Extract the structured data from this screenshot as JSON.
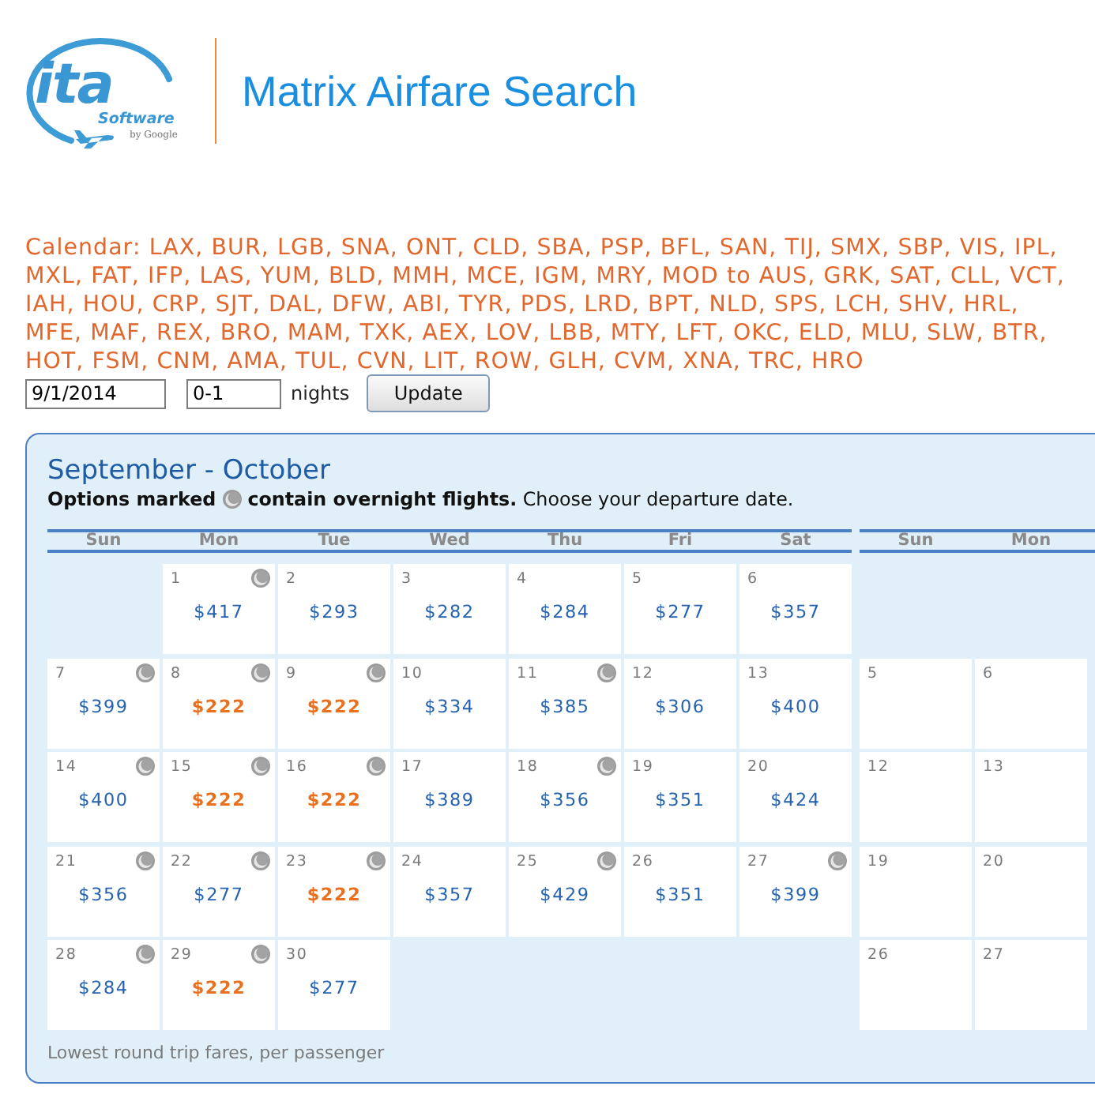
{
  "header": {
    "logo": {
      "wordmark": "ita",
      "product": "Software",
      "byline": "by Google"
    },
    "title": "Matrix Airfare Search"
  },
  "route": "Calendar: LAX, BUR, LGB, SNA, ONT, CLD, SBA, PSP, BFL, SAN, TIJ, SMX, SBP, VIS, IPL, MXL, FAT, IFP, LAS, YUM, BLD, MMH, MCE, IGM, MRY, MOD to AUS, GRK, SAT, CLL, VCT, IAH, HOU, CRP, SJT, DAL, DFW, ABI, TYR, PDS, LRD, BPT, NLD, SPS, LCH, SHV, HRL, MFE, MAF, REX, BRO, MAM, TXK, AEX, LOV, LBB, MTY, LFT, OKC, ELD, MLU, SLW, BTR, HOT, FSM, CNM, AMA, TUL, CVN, LIT, ROW, GLH, CVM, XNA, TRC, HRO",
  "form": {
    "date": "9/1/2014",
    "nights": "0-1",
    "nights_label": "nights",
    "button": "Update"
  },
  "calendar": {
    "title": "September - October",
    "legend": {
      "lead": "Options marked",
      "rest": "**contain overnight flights.** Choose your departure date."
    },
    "months": [
      {
        "weekdays": [
          "Sun",
          "Mon",
          "Tue",
          "Wed",
          "Thu",
          "Fri",
          "Sat"
        ],
        "weeks": [
          [
            {
              "kind": "empty"
            },
            {
              "kind": "day",
              "day": "1",
              "price": "$417",
              "overnight": true,
              "lowest": false
            },
            {
              "kind": "day",
              "day": "2",
              "price": "$293",
              "overnight": false,
              "lowest": false
            },
            {
              "kind": "day",
              "day": "3",
              "price": "$282",
              "overnight": false,
              "lowest": false
            },
            {
              "kind": "day",
              "day": "4",
              "price": "$284",
              "overnight": false,
              "lowest": false
            },
            {
              "kind": "day",
              "day": "5",
              "price": "$277",
              "overnight": false,
              "lowest": false
            },
            {
              "kind": "day",
              "day": "6",
              "price": "$357",
              "overnight": false,
              "lowest": false
            }
          ],
          [
            {
              "kind": "day",
              "day": "7",
              "price": "$399",
              "overnight": true,
              "lowest": false
            },
            {
              "kind": "day",
              "day": "8",
              "price": "$222",
              "overnight": true,
              "lowest": true
            },
            {
              "kind": "day",
              "day": "9",
              "price": "$222",
              "overnight": true,
              "lowest": true
            },
            {
              "kind": "day",
              "day": "10",
              "price": "$334",
              "overnight": false,
              "lowest": false
            },
            {
              "kind": "day",
              "day": "11",
              "price": "$385",
              "overnight": true,
              "lowest": false
            },
            {
              "kind": "day",
              "day": "12",
              "price": "$306",
              "overnight": false,
              "lowest": false
            },
            {
              "kind": "day",
              "day": "13",
              "price": "$400",
              "overnight": false,
              "lowest": false
            }
          ],
          [
            {
              "kind": "day",
              "day": "14",
              "price": "$400",
              "overnight": true,
              "lowest": false
            },
            {
              "kind": "day",
              "day": "15",
              "price": "$222",
              "overnight": true,
              "lowest": true
            },
            {
              "kind": "day",
              "day": "16",
              "price": "$222",
              "overnight": true,
              "lowest": true
            },
            {
              "kind": "day",
              "day": "17",
              "price": "$389",
              "overnight": false,
              "lowest": false
            },
            {
              "kind": "day",
              "day": "18",
              "price": "$356",
              "overnight": true,
              "lowest": false
            },
            {
              "kind": "day",
              "day": "19",
              "price": "$351",
              "overnight": false,
              "lowest": false
            },
            {
              "kind": "day",
              "day": "20",
              "price": "$424",
              "overnight": false,
              "lowest": false
            }
          ],
          [
            {
              "kind": "day",
              "day": "21",
              "price": "$356",
              "overnight": true,
              "lowest": false
            },
            {
              "kind": "day",
              "day": "22",
              "price": "$277",
              "overnight": true,
              "lowest": false
            },
            {
              "kind": "day",
              "day": "23",
              "price": "$222",
              "overnight": true,
              "lowest": true
            },
            {
              "kind": "day",
              "day": "24",
              "price": "$357",
              "overnight": false,
              "lowest": false
            },
            {
              "kind": "day",
              "day": "25",
              "price": "$429",
              "overnight": true,
              "lowest": false
            },
            {
              "kind": "day",
              "day": "26",
              "price": "$351",
              "overnight": false,
              "lowest": false
            },
            {
              "kind": "day",
              "day": "27",
              "price": "$399",
              "overnight": true,
              "lowest": false
            }
          ],
          [
            {
              "kind": "day",
              "day": "28",
              "price": "$284",
              "overnight": true,
              "lowest": false
            },
            {
              "kind": "day",
              "day": "29",
              "price": "$222",
              "overnight": true,
              "lowest": true
            },
            {
              "kind": "day",
              "day": "30",
              "price": "$277",
              "overnight": false,
              "lowest": false
            },
            {
              "kind": "empty"
            },
            {
              "kind": "empty"
            },
            {
              "kind": "empty"
            },
            {
              "kind": "empty"
            }
          ]
        ]
      },
      {
        "weekdays": [
          "Sun",
          "Mon"
        ],
        "weeks": [
          [
            {
              "kind": "empty"
            },
            {
              "kind": "empty"
            }
          ],
          [
            {
              "kind": "day",
              "day": "5",
              "overnight": false
            },
            {
              "kind": "day",
              "day": "6",
              "overnight": false
            }
          ],
          [
            {
              "kind": "day",
              "day": "12",
              "overnight": false
            },
            {
              "kind": "day",
              "day": "13",
              "overnight": false
            }
          ],
          [
            {
              "kind": "day",
              "day": "19",
              "overnight": false
            },
            {
              "kind": "day",
              "day": "20",
              "overnight": false
            }
          ],
          [
            {
              "kind": "day",
              "day": "26",
              "overnight": false
            },
            {
              "kind": "day",
              "day": "27",
              "overnight": false
            }
          ]
        ]
      }
    ],
    "footnote": "Lowest round trip fares, per passenger"
  }
}
